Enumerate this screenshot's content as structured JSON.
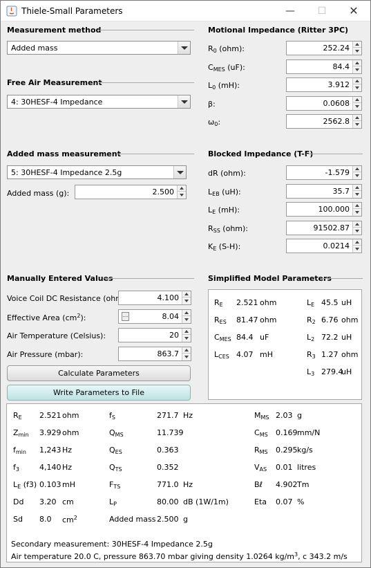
{
  "window": {
    "title": "Thiele-Small Parameters",
    "controls": {
      "minimize": "—",
      "maximize": "☐",
      "close": "✕"
    }
  },
  "measurement_method": {
    "heading": "Measurement method",
    "selected": "Added mass"
  },
  "free_air": {
    "heading": "Free Air Measurement",
    "selected": "4: 30HESF-4 Impedance"
  },
  "added_mass": {
    "heading": "Added mass measurement",
    "selected": "5: 30HESF-4 Impedance 2.5g",
    "mass_label": "Added mass (g):",
    "mass_value": "2.500"
  },
  "motional": {
    "heading": "Motional Impedance (Ritter 3PC)",
    "rows": [
      {
        "sym": "R",
        "sub": "0",
        "unit": " (ohm):",
        "value": "252.24"
      },
      {
        "sym": "C",
        "sub": "MES",
        "unit": " (uF):",
        "value": "84.4"
      },
      {
        "sym": "L",
        "sub": "0",
        "unit": " (mH):",
        "value": "3.912"
      },
      {
        "sym": "β:",
        "sub": "",
        "unit": "",
        "value": "0.0608"
      },
      {
        "sym": "ω",
        "sub": "0",
        "unit": ":",
        "value": "2562.8"
      }
    ]
  },
  "blocked": {
    "heading": "Blocked Impedance (T-F)",
    "rows": [
      {
        "sym": "dR (ohm):",
        "sub": "",
        "unit": "",
        "value": "-1.579"
      },
      {
        "sym": "L",
        "sub": "EB",
        "unit": " (uH):",
        "value": "35.7"
      },
      {
        "sym": "L",
        "sub": "E",
        "unit": " (mH):",
        "value": "100.000"
      },
      {
        "sym": "R",
        "sub": "SS",
        "unit": " (ohm):",
        "value": "91502.87"
      },
      {
        "sym": "K",
        "sub": "E",
        "unit": " (S-H):",
        "value": "0.0214"
      }
    ]
  },
  "manual": {
    "heading": "Manually Entered Values",
    "rows": [
      {
        "label": "Voice Coil DC Resistance (ohm):",
        "value": "4.100"
      },
      {
        "label": "Effective Area (cm",
        "sup": "2",
        "label_end": "):",
        "value": "8.04"
      },
      {
        "label": "Air Temperature (Celsius):",
        "value": "20"
      },
      {
        "label": "Air Pressure (mbar):",
        "value": "863.7"
      }
    ],
    "calculate_button": "Calculate Parameters",
    "write_button": "Write Parameters to File"
  },
  "simplified": {
    "heading": "Simplified Model Parameters",
    "left": [
      {
        "sym": "R",
        "sub": "E",
        "value": "2.521",
        "unit": "ohm"
      },
      {
        "sym": "R",
        "sub": "ES",
        "value": "81.47",
        "unit": "ohm"
      },
      {
        "sym": "C",
        "sub": "MES",
        "value": "84.4",
        "unit": "uF"
      },
      {
        "sym": "L",
        "sub": "CES",
        "value": "4.07",
        "unit": "mH"
      }
    ],
    "right": [
      {
        "sym": "L",
        "sub": "E",
        "value": "45.5",
        "unit": "uH"
      },
      {
        "sym": "R",
        "sub": "2",
        "value": "6.76",
        "unit": "ohm"
      },
      {
        "sym": "L",
        "sub": "2",
        "value": "72.2",
        "unit": "uH"
      },
      {
        "sym": "R",
        "sub": "3",
        "value": "1.27",
        "unit": "ohm"
      },
      {
        "sym": "L",
        "sub": "3",
        "value": "279.4",
        "unit": "uH"
      }
    ]
  },
  "results": {
    "col1": [
      {
        "sym": "R",
        "sub": "E",
        "post": "",
        "value": "2.521",
        "unit": "ohm"
      },
      {
        "sym": "Z",
        "sub": "min",
        "post": "",
        "value": "3.929",
        "unit": "ohm"
      },
      {
        "sym": "f",
        "sub": "min",
        "post": "",
        "value": "1,243",
        "unit": "Hz"
      },
      {
        "sym": "f",
        "sub": "3",
        "post": "",
        "value": "4,140",
        "unit": "Hz"
      },
      {
        "sym": "L",
        "sub": "E",
        "post": " (f3)",
        "value": "0.103",
        "unit": "mH"
      },
      {
        "sym": "Dd",
        "sub": "",
        "post": "",
        "value": "3.20",
        "unit": "cm"
      },
      {
        "sym": "Sd",
        "sub": "",
        "post": "",
        "value": "8.0",
        "unit": "cm",
        "unit_sup": "2"
      }
    ],
    "col2": [
      {
        "sym": "f",
        "sub": "S",
        "value": "271.7",
        "unit": "Hz"
      },
      {
        "sym": "Q",
        "sub": "MS",
        "value": "11.739",
        "unit": ""
      },
      {
        "sym": "Q",
        "sub": "ES",
        "value": "0.363",
        "unit": ""
      },
      {
        "sym": "Q",
        "sub": "TS",
        "value": "0.352",
        "unit": ""
      },
      {
        "sym": "F",
        "sub": "TS",
        "value": "771.0",
        "unit": "Hz"
      },
      {
        "sym": "L",
        "sub": "P",
        "value": "80.00",
        "unit": "dB (1W/1m)"
      },
      {
        "sym": "Added mass",
        "sub": "",
        "value": "2.500",
        "unit": "g"
      }
    ],
    "col3": [
      {
        "sym": "M",
        "sub": "MS",
        "value": "2.03",
        "unit": "g"
      },
      {
        "sym": "C",
        "sub": "MS",
        "value": "0.169",
        "unit": "mm/N"
      },
      {
        "sym": "R",
        "sub": "MS",
        "value": "0.295",
        "unit": "kg/s"
      },
      {
        "sym": "V",
        "sub": "AS",
        "value": "0.01",
        "unit": "litres"
      },
      {
        "sym": "Bℓ",
        "sub": "",
        "value": "4.902",
        "unit": "Tm"
      },
      {
        "sym": "Eta",
        "sub": "",
        "value": "0.07",
        "unit": "%"
      }
    ],
    "secondary": "Secondary measurement: 30HESF-4 Impedance 2.5g",
    "air_a": "Air temperature 20.0 C, pressure 863.70 mbar giving density 1.0264 kg/m",
    "air_sup": "3",
    "air_b": ", c 343.2 m/s"
  }
}
